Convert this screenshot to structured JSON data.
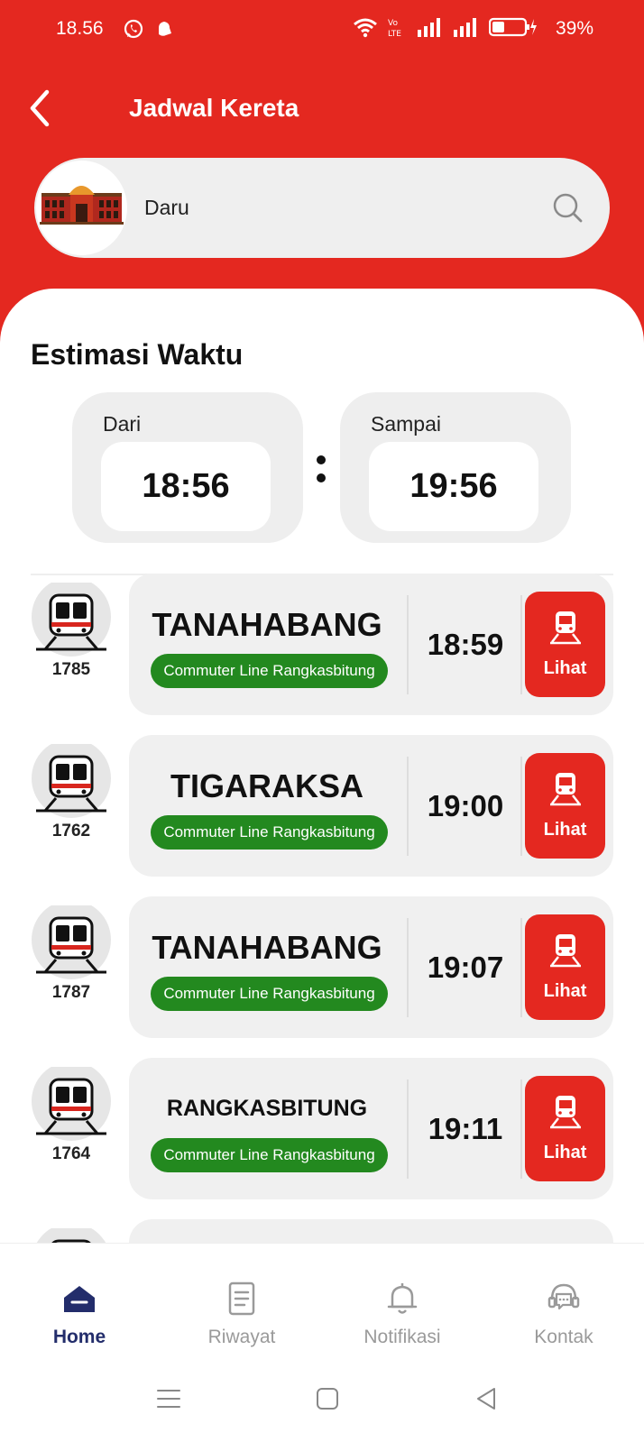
{
  "status_bar": {
    "time": "18.56",
    "battery": "39%"
  },
  "header": {
    "title": "Jadwal Kereta"
  },
  "search": {
    "value": "Daru"
  },
  "estimasi": {
    "title": "Estimasi Waktu",
    "from": {
      "label": "Dari",
      "time": "18:56"
    },
    "to": {
      "label": "Sampai",
      "time": "19:56"
    }
  },
  "trains": [
    {
      "number": "1785",
      "destination": "TANAHABANG",
      "line": "Commuter Line Rangkasbitung",
      "time": "18:59",
      "action": "Lihat"
    },
    {
      "number": "1762",
      "destination": "TIGARAKSA",
      "line": "Commuter Line Rangkasbitung",
      "time": "19:00",
      "action": "Lihat"
    },
    {
      "number": "1787",
      "destination": "TANAHABANG",
      "line": "Commuter Line Rangkasbitung",
      "time": "19:07",
      "action": "Lihat"
    },
    {
      "number": "1764",
      "destination": "RANGKASBITUNG",
      "line": "Commuter Line Rangkasbitung",
      "time": "19:11",
      "action": "Lihat"
    }
  ],
  "nav": {
    "home": "Home",
    "riwayat": "Riwayat",
    "notifikasi": "Notifikasi",
    "kontak": "Kontak"
  },
  "colors": {
    "primary": "#e42820",
    "badge": "#23891f",
    "nav_active": "#232d6b"
  }
}
